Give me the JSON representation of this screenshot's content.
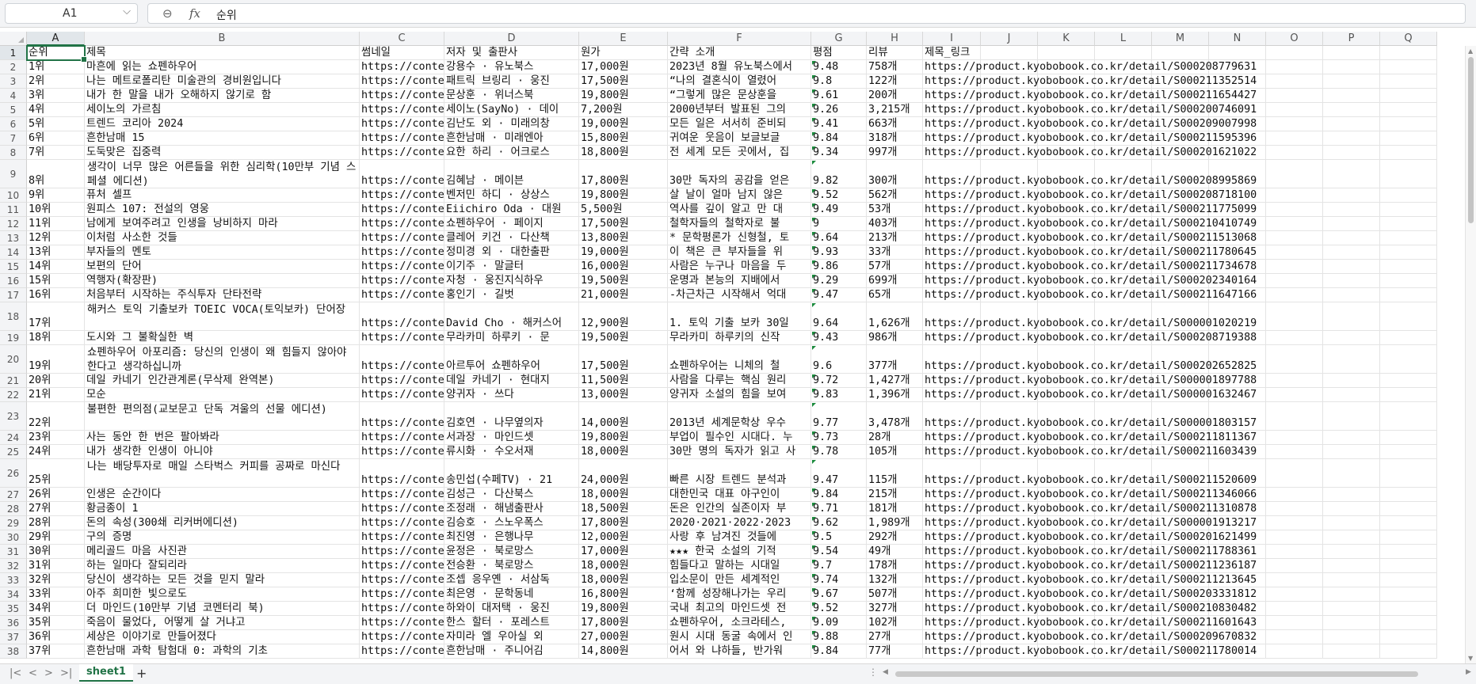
{
  "formula_bar": {
    "name_box": "A1",
    "name_box_arrow": "⌵",
    "zoom_icon": "⊖",
    "fx_label": "fx",
    "formula": "순위"
  },
  "columns": [
    "A",
    "B",
    "C",
    "D",
    "E",
    "F",
    "G",
    "H",
    "I",
    "J",
    "K",
    "L",
    "M",
    "N",
    "O",
    "P",
    "Q"
  ],
  "selected_cell": "A1",
  "rows": [
    {
      "num": "1",
      "A": "순위",
      "B": "제목",
      "C": "썸네일",
      "D": "저자 및 출판사",
      "E": "원가",
      "F": "간략 소개",
      "G": "평점",
      "H": "리뷰",
      "I": "제목_링크"
    },
    {
      "num": "2",
      "A": "1위",
      "B": "마흔에 읽는 쇼펜하우어",
      "C": "https://conte",
      "D": "강용수 · 유노북스",
      "E": "17,000원",
      "F": "2023년 8월 유노북스에서",
      "G": "9.48",
      "H": "758개",
      "I": "https://product.kyobobook.co.kr/detail/S000208779631"
    },
    {
      "num": "3",
      "A": "2위",
      "B": "나는 메트로폴리탄 미술관의 경비원입니다",
      "C": "https://conte",
      "D": "패트릭 브링리 · 웅진",
      "E": "17,500원",
      "F": "“나의 결혼식이 열렸어",
      "G": "9.8",
      "H": "122개",
      "I": "https://product.kyobobook.co.kr/detail/S000211352514"
    },
    {
      "num": "4",
      "A": "3위",
      "B": "내가 한 말을 내가 오해하지 않기로 함",
      "C": "https://conte",
      "D": "문상훈 · 위너스북",
      "E": "19,800원",
      "F": "“그렇게 많은 문상훈을",
      "G": "9.61",
      "H": "200개",
      "I": "https://product.kyobobook.co.kr/detail/S000211654427"
    },
    {
      "num": "5",
      "A": "4위",
      "B": "세이노의 가르침",
      "C": "https://conte",
      "D": "세이노(SayNo) · 데이",
      "E": "7,200원",
      "F": "2000년부터 발표된 그의",
      "G": "9.26",
      "H": "3,215개",
      "I": "https://product.kyobobook.co.kr/detail/S000200746091"
    },
    {
      "num": "6",
      "A": "5위",
      "B": "트렌드 코리아 2024",
      "C": "https://conte",
      "D": "김난도 외 · 미래의창",
      "E": "19,000원",
      "F": "모든 일은 서서히 준비되",
      "G": "9.41",
      "H": "663개",
      "I": "https://product.kyobobook.co.kr/detail/S000209007998"
    },
    {
      "num": "7",
      "A": "6위",
      "B": "흔한남매 15",
      "C": "https://conte",
      "D": "흔한남매 · 미래엔아",
      "E": "15,800원",
      "F": "귀여운 웃음이 보글보글",
      "G": "9.84",
      "H": "318개",
      "I": "https://product.kyobobook.co.kr/detail/S000211595396"
    },
    {
      "num": "8",
      "A": "7위",
      "B": "도둑맞은 집중력",
      "C": "https://conte",
      "D": "요한 하리 · 어크로스",
      "E": "18,800원",
      "F": "전 세계 모든 곳에서, 집",
      "G": "9.34",
      "H": "997개",
      "I": "https://product.kyobobook.co.kr/detail/S000201621022"
    },
    {
      "num": "9",
      "A": "8위",
      "B": "생각이 너무 많은 어른들을 위한 심리학(10만부 기념 스페셜 에디션)",
      "C": "https://conte",
      "D": "김혜남 · 메이븐",
      "E": "17,800원",
      "F": "30만 독자의 공감을 얻은",
      "G": "9.82",
      "H": "300개",
      "I": "https://product.kyobobook.co.kr/detail/S000208995869"
    },
    {
      "num": "10",
      "A": "9위",
      "B": "퓨처 셀프",
      "C": "https://conte",
      "D": "벤저민 하디 · 상상스",
      "E": "19,800원",
      "F": "살 날이 얼마 남지 않은",
      "G": "9.52",
      "H": "562개",
      "I": "https://product.kyobobook.co.kr/detail/S000208718100"
    },
    {
      "num": "11",
      "A": "10위",
      "B": "원피스 107: 전설의 영웅",
      "C": "https://conte",
      "D": "Eiichiro Oda · 대원",
      "E": "5,500원",
      "F": "역사를 깊이 알고 만 대",
      "G": "9.49",
      "H": "53개",
      "I": "https://product.kyobobook.co.kr/detail/S000211775099"
    },
    {
      "num": "12",
      "A": "11위",
      "B": "남에게 보여주려고 인생을 낭비하지 마라",
      "C": "https://conte",
      "D": "쇼펜하우어 · 페이지",
      "E": "17,500원",
      "F": "철학자들의 철학자로 불",
      "G": "9",
      "H": "403개",
      "I": "https://product.kyobobook.co.kr/detail/S000210410749"
    },
    {
      "num": "13",
      "A": "12위",
      "B": "이처럼 사소한 것들",
      "C": "https://conte",
      "D": "클레어 키건 · 다산책",
      "E": "13,800원",
      "F": "* 문학평론가 신형철, 토",
      "G": "9.64",
      "H": "213개",
      "I": "https://product.kyobobook.co.kr/detail/S000211513068"
    },
    {
      "num": "14",
      "A": "13위",
      "B": "부자들의 멘토",
      "C": "https://conte",
      "D": "정미경 외 · 대한출판",
      "E": "19,000원",
      "F": "이 책은 큰 부자들을 위",
      "G": "9.93",
      "H": "33개",
      "I": "https://product.kyobobook.co.kr/detail/S000211780645"
    },
    {
      "num": "15",
      "A": "14위",
      "B": "보편의 단어",
      "C": "https://conte",
      "D": "이기주 · 말글터",
      "E": "16,000원",
      "F": "사람은 누구나 마음을 두",
      "G": "9.86",
      "H": "57개",
      "I": "https://product.kyobobook.co.kr/detail/S000211734678"
    },
    {
      "num": "16",
      "A": "15위",
      "B": "역행자(확장판)",
      "C": "https://conte",
      "D": "자청 · 웅진지식하우",
      "E": "19,500원",
      "F": "운명과 본능의 지배에서",
      "G": "9.29",
      "H": "699개",
      "I": "https://product.kyobobook.co.kr/detail/S000202340164"
    },
    {
      "num": "17",
      "A": "16위",
      "B": "처음부터 시작하는 주식투자 단타전략",
      "C": "https://conte",
      "D": "홍인기 · 길벗",
      "E": "21,000원",
      "F": "-차근차근 시작해서 억대",
      "G": "9.47",
      "H": "65개",
      "I": "https://product.kyobobook.co.kr/detail/S000211647166"
    },
    {
      "num": "18",
      "A": "17위",
      "B": "해커스 토익 기출보카 TOEIC VOCA(토익보카) 단어장",
      "C": "https://conte",
      "D": "David Cho · 해커스어",
      "E": "12,900원",
      "F": "1. 토익 기출 보카 30일",
      "G": "9.64",
      "H": "1,626개",
      "I": "https://product.kyobobook.co.kr/detail/S000001020219"
    },
    {
      "num": "19",
      "A": "18위",
      "B": "도시와 그 불확실한 벽",
      "C": "https://conte",
      "D": "무라카미 하루키 · 문",
      "E": "19,500원",
      "F": "무라카미 하루키의 신작",
      "G": "9.43",
      "H": "986개",
      "I": "https://product.kyobobook.co.kr/detail/S000208719388"
    },
    {
      "num": "20",
      "A": "19위",
      "B": "쇼펜하우어 아포리즘: 당신의 인생이 왜 힘들지 않아야 한다고 생각하십니까",
      "C": "https://conte",
      "D": "아르투어 쇼펜하우어",
      "E": "17,500원",
      "F": "쇼펜하우어는 니체의 철",
      "G": "9.6",
      "H": "377개",
      "I": "https://product.kyobobook.co.kr/detail/S000202652825"
    },
    {
      "num": "21",
      "A": "20위",
      "B": "데일 카네기 인간관계론(무삭제 완역본)",
      "C": "https://conte",
      "D": "데일 카네기 · 현대지",
      "E": "11,500원",
      "F": "사람을 다루는 핵심 원리",
      "G": "9.72",
      "H": "1,427개",
      "I": "https://product.kyobobook.co.kr/detail/S000001897788"
    },
    {
      "num": "22",
      "A": "21위",
      "B": "모순",
      "C": "https://conte",
      "D": "양귀자 · 쓰다",
      "E": "13,000원",
      "F": "양귀자 소설의 힘을 보여",
      "G": "9.83",
      "H": "1,396개",
      "I": "https://product.kyobobook.co.kr/detail/S000001632467"
    },
    {
      "num": "23",
      "A": "22위",
      "B": "불편한 편의점(교보문고 단독 겨울의 선물 에디션)",
      "C": "https://conte",
      "D": "김호연 · 나무옆의자",
      "E": "14,000원",
      "F": "2013년 세계문학상 우수",
      "G": "9.77",
      "H": "3,478개",
      "I": "https://product.kyobobook.co.kr/detail/S000001803157"
    },
    {
      "num": "24",
      "A": "23위",
      "B": "사는 동안 한 번은 팔아봐라",
      "C": "https://conte",
      "D": "서과장 · 마인드셋",
      "E": "19,800원",
      "F": "부업이 필수인 시대다. 누",
      "G": "9.73",
      "H": "28개",
      "I": "https://product.kyobobook.co.kr/detail/S000211811367"
    },
    {
      "num": "25",
      "A": "24위",
      "B": "내가 생각한 인생이 아니야",
      "C": "https://conte",
      "D": "류시화 · 수오서재",
      "E": "18,000원",
      "F": "30만 명의 독자가 읽고 사",
      "G": "9.78",
      "H": "105개",
      "I": "https://product.kyobobook.co.kr/detail/S000211603439"
    },
    {
      "num": "26",
      "A": "25위",
      "B": "나는 배당투자로 매일 스타벅스 커피를 공짜로 마신다",
      "C": "https://conte",
      "D": "송민섭(수페TV) · 21",
      "E": "24,000원",
      "F": "빠른 시장 트렌드 분석과",
      "G": "9.47",
      "H": "115개",
      "I": "https://product.kyobobook.co.kr/detail/S000211520609"
    },
    {
      "num": "27",
      "A": "26위",
      "B": "인생은 순간이다",
      "C": "https://conte",
      "D": "김성근 · 다산북스",
      "E": "18,000원",
      "F": "대한민국 대표 야구인이",
      "G": "9.84",
      "H": "215개",
      "I": "https://product.kyobobook.co.kr/detail/S000211346066"
    },
    {
      "num": "28",
      "A": "27위",
      "B": "황금종이 1",
      "C": "https://conte",
      "D": "조정래 · 해냄출판사",
      "E": "18,500원",
      "F": "돈은 인간의 실존이자 부",
      "G": "9.71",
      "H": "181개",
      "I": "https://product.kyobobook.co.kr/detail/S000211310878"
    },
    {
      "num": "29",
      "A": "28위",
      "B": "돈의 속성(300쇄 리커버에디션)",
      "C": "https://conte",
      "D": "김승호 · 스노우폭스",
      "E": "17,800원",
      "F": "2020·2021·2022·2023",
      "G": "9.62",
      "H": "1,989개",
      "I": "https://product.kyobobook.co.kr/detail/S000001913217"
    },
    {
      "num": "30",
      "A": "29위",
      "B": "구의 증명",
      "C": "https://conte",
      "D": "최진영 · 은행나무",
      "E": "12,000원",
      "F": "사랑 후 남겨진 것들에",
      "G": "9.5",
      "H": "292개",
      "I": "https://product.kyobobook.co.kr/detail/S000201621499"
    },
    {
      "num": "31",
      "A": "30위",
      "B": "메리골드 마음 사진관",
      "C": "https://conte",
      "D": "윤정은 · 북로망스",
      "E": "17,000원",
      "F": "★★★ 한국 소설의 기적",
      "G": "9.54",
      "H": "49개",
      "I": "https://product.kyobobook.co.kr/detail/S000211788361"
    },
    {
      "num": "32",
      "A": "31위",
      "B": "하는 일마다 잘되리라",
      "C": "https://conte",
      "D": "전승환 · 북로망스",
      "E": "18,000원",
      "F": "힘들다고 말하는 시대일",
      "G": "9.7",
      "H": "178개",
      "I": "https://product.kyobobook.co.kr/detail/S000211236187"
    },
    {
      "num": "33",
      "A": "32위",
      "B": "당신이 생각하는 모든 것을 믿지 말라",
      "C": "https://conte",
      "D": "조셉 응우옌 · 서삼독",
      "E": "18,000원",
      "F": "입소문이 만든 세계적인",
      "G": "9.74",
      "H": "132개",
      "I": "https://product.kyobobook.co.kr/detail/S000211213645"
    },
    {
      "num": "34",
      "A": "33위",
      "B": "아주 희미한 빛으로도",
      "C": "https://conte",
      "D": "최은영 · 문학동네",
      "E": "16,800원",
      "F": "‘함께 성장해나가는 우리",
      "G": "9.67",
      "H": "507개",
      "I": "https://product.kyobobook.co.kr/detail/S000203331812"
    },
    {
      "num": "35",
      "A": "34위",
      "B": "더 마인드(10만부 기념 코멘터리 북)",
      "C": "https://conte",
      "D": "하와이 대저택 · 웅진",
      "E": "19,800원",
      "F": "국내 최고의 마인드셋 전",
      "G": "9.52",
      "H": "327개",
      "I": "https://product.kyobobook.co.kr/detail/S000210830482"
    },
    {
      "num": "36",
      "A": "35위",
      "B": "죽음이 물었다, 어떻게 살 거냐고",
      "C": "https://conte",
      "D": "한스 할터 · 포레스트",
      "E": "17,800원",
      "F": "쇼펜하우어, 소크라테스,",
      "G": "9.09",
      "H": "102개",
      "I": "https://product.kyobobook.co.kr/detail/S000211601643"
    },
    {
      "num": "37",
      "A": "36위",
      "B": "세상은 이야기로 만들어졌다",
      "C": "https://conte",
      "D": "자미라 엘 우아실 외",
      "E": "27,000원",
      "F": "원시 시대 동굴 속에서 인",
      "G": "9.88",
      "H": "27개",
      "I": "https://product.kyobobook.co.kr/detail/S000209670832"
    },
    {
      "num": "38",
      "A": "37위",
      "B": "흔한남매 과학 탐험대 0: 과학의 기초",
      "C": "https://conte",
      "D": "흔한남매 · 주니어김",
      "E": "14,800원",
      "F": "어서 와 냐하들, 반가워",
      "G": "9.84",
      "H": "77개",
      "I": "https://product.kyobobook.co.kr/detail/S000211780014"
    }
  ],
  "sheet_tabs": [
    "sheet1"
  ],
  "add_sheet_label": "+",
  "nav_icons": [
    "|<",
    "<",
    ">",
    ">|"
  ],
  "scroll_arrows": {
    "up": "▲",
    "down": "▼",
    "left": "◀",
    "right": "▶"
  },
  "accent_color": "#217346"
}
